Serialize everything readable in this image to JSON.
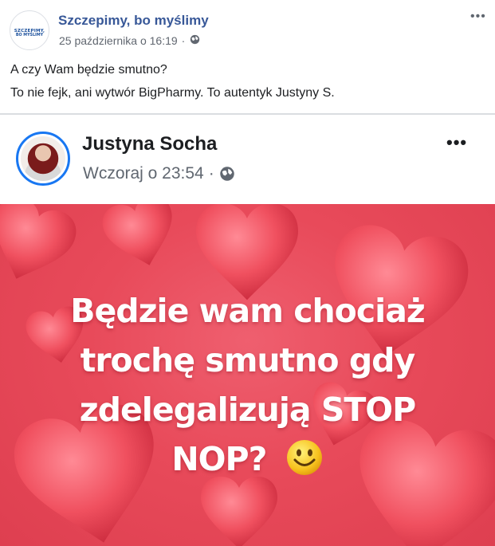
{
  "post": {
    "page_name": "Szczepimy, bo myślimy",
    "logo_text_top": "SZCZEPIMY,",
    "logo_text_bottom": "BO MYŚLIMY",
    "timestamp": "25 października o 16:19",
    "separator": "·",
    "more_label": "•••",
    "text_lines": [
      "A czy Wam będzie smutno?",
      "To nie fejk, ani wytwór BigPharmy. To autentyk Justyny S."
    ]
  },
  "shared_post": {
    "author": "Justyna Socha",
    "timestamp": "Wczoraj o 23:54",
    "separator": "·",
    "more_label": "•••",
    "meme_lines": [
      "Będzie wam chociaż",
      "trochę smutno gdy",
      "zdelegalizują STOP",
      "NOP?"
    ]
  },
  "colors": {
    "page_name": "#385898",
    "meme_background": "#e84a5a",
    "heart": "#f0505f",
    "avatar_ring": "#1877f2"
  },
  "icons": {
    "privacy": "globe-icon",
    "emoji": "smiley-face-icon"
  }
}
